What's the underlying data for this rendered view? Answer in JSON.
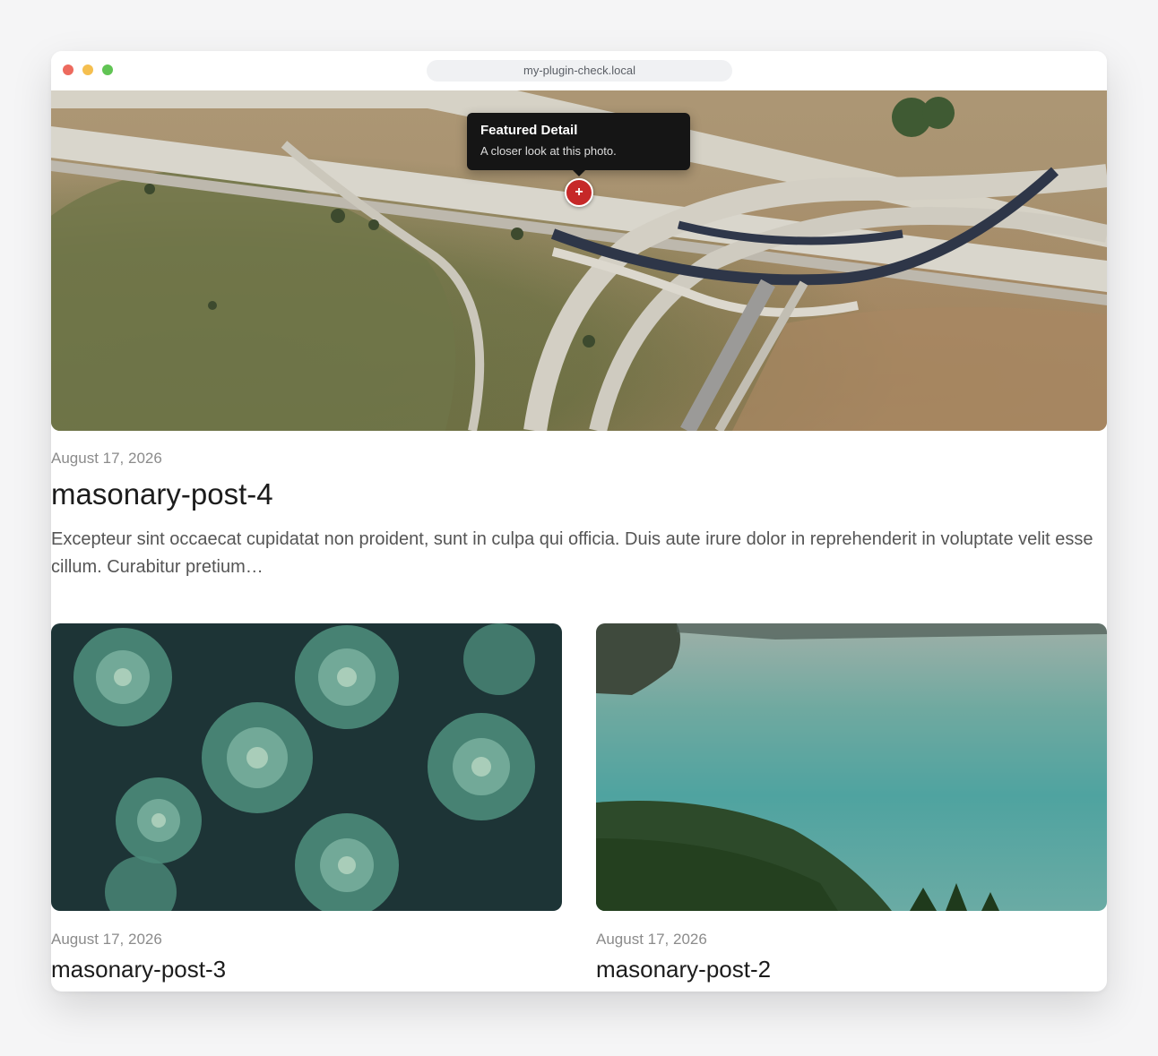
{
  "browser": {
    "url": "my-plugin-check.local"
  },
  "featured": {
    "image_alt": "Aerial view of a highway interchange",
    "hotspot_icon": "plus-icon",
    "hotspot_symbol": "+",
    "tooltip": {
      "title": "Featured Detail",
      "body": "A closer look at this photo."
    },
    "date": "August 17, 2026",
    "title": "masonary-post-4",
    "excerpt": "Excepteur sint occaecat cupidatat non proident, sunt in culpa qui officia. Duis aute irure dolor in reprehenderit in voluptate velit esse cillum. Curabitur pretium…"
  },
  "posts": [
    {
      "date": "August 17, 2026",
      "title": "masonary-post-3",
      "image_alt": "Succulent plants close-up"
    },
    {
      "date": "August 17, 2026",
      "title": "masonary-post-2",
      "image_alt": "Lake with forested hills"
    }
  ],
  "colors": {
    "hotspot": "#c62828",
    "tooltip_bg": "#151515",
    "traffic_red": "#ed6a5e",
    "traffic_yellow": "#f5bf4f",
    "traffic_green": "#61c454"
  }
}
